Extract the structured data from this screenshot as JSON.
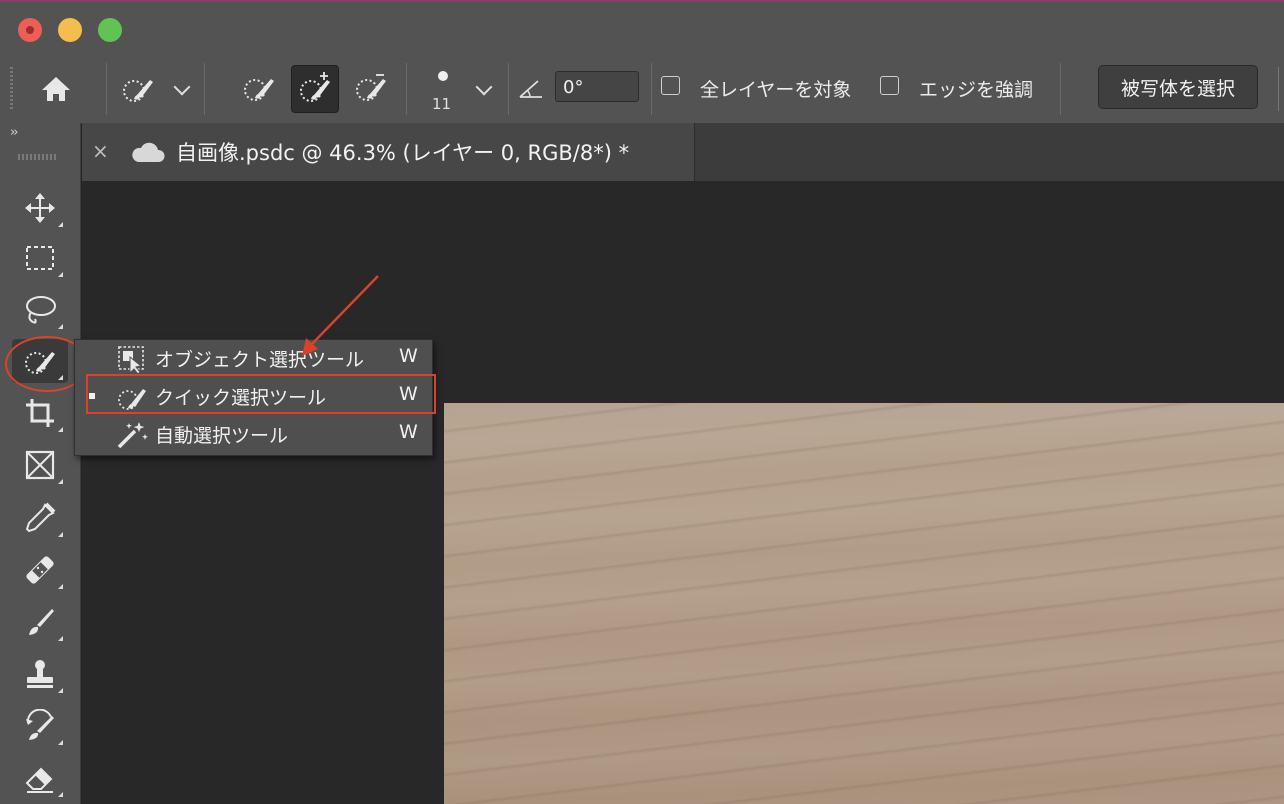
{
  "window": {
    "traffic_lights": [
      "close",
      "minimize",
      "zoom"
    ]
  },
  "options_bar": {
    "brush_size": "11",
    "angle_value": "0°",
    "sample_all_layers_label": "全レイヤーを対象",
    "enhance_edge_label": "エッジを強調",
    "select_subject_label": "被写体を選択"
  },
  "document_tab": {
    "close_glyph": "×",
    "title": "自画像.psdc @ 46.3% (レイヤー 0, RGB/8*) *"
  },
  "toolbar": {
    "collapse_glyph": "››",
    "tools": [
      {
        "name": "move-tool",
        "icon": "move-icon"
      },
      {
        "name": "marquee-tool",
        "icon": "rect-marquee-icon"
      },
      {
        "name": "lasso-tool",
        "icon": "lasso-icon"
      },
      {
        "name": "quick-selection-tool",
        "icon": "quick-selection-icon",
        "active": true
      },
      {
        "name": "crop-tool",
        "icon": "crop-icon"
      },
      {
        "name": "frame-tool",
        "icon": "frame-icon"
      },
      {
        "name": "eyedropper-tool",
        "icon": "eyedropper-icon"
      },
      {
        "name": "healing-brush-tool",
        "icon": "bandage-icon"
      },
      {
        "name": "brush-tool",
        "icon": "brush-icon"
      },
      {
        "name": "clone-stamp-tool",
        "icon": "stamp-icon"
      },
      {
        "name": "history-brush-tool",
        "icon": "history-brush-icon"
      },
      {
        "name": "eraser-tool",
        "icon": "eraser-icon"
      }
    ]
  },
  "flyout": {
    "items": [
      {
        "label": "オブジェクト選択ツール",
        "shortcut": "W",
        "icon": "object-selection-icon",
        "current": false
      },
      {
        "label": "クイック選択ツール",
        "shortcut": "W",
        "icon": "quick-selection-icon",
        "current": true
      },
      {
        "label": "自動選択ツール",
        "shortcut": "W",
        "icon": "magic-wand-icon",
        "current": false
      }
    ]
  },
  "annotations": {
    "highlight_color": "#d9432c"
  },
  "colors": {
    "ui_panel": "#535353",
    "canvas_bg": "#282828",
    "image_wood": "#b09a85"
  }
}
